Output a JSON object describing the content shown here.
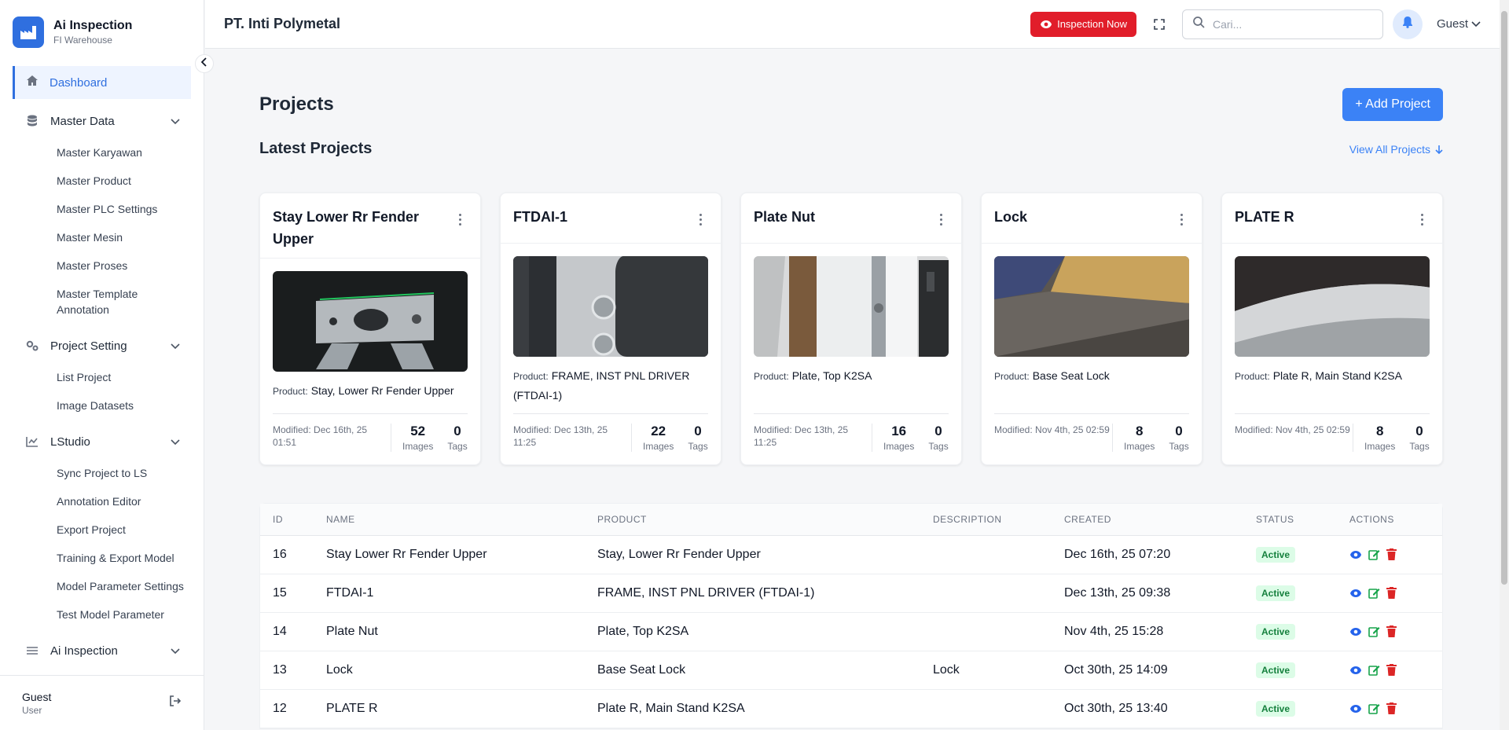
{
  "sidebar": {
    "brand_title": "Ai Inspection",
    "brand_subtitle": "FI Warehouse",
    "dashboard_label": "Dashboard",
    "sections": [
      {
        "label": "Master Data",
        "items": [
          "Master Karyawan",
          "Master Product",
          "Master PLC Settings",
          "Master Mesin",
          "Master Proses",
          "Master Template Annotation"
        ]
      },
      {
        "label": "Project Setting",
        "items": [
          "List Project",
          "Image Datasets"
        ]
      },
      {
        "label": "LStudio",
        "items": [
          "Sync Project to LS",
          "Annotation Editor",
          "Export Project",
          "Training & Export Model",
          "Model Parameter Settings",
          "Test Model Parameter"
        ]
      },
      {
        "label": "Ai Inspection",
        "items": []
      }
    ],
    "footer": {
      "name": "Guest",
      "role": "User"
    }
  },
  "header": {
    "company": "PT. Inti Polymetal",
    "inspection_button": "Inspection Now",
    "search_placeholder": "Cari...",
    "user_label": "Guest"
  },
  "main": {
    "page_title": "Projects",
    "add_button": "+ Add Project",
    "latest_title": "Latest Projects",
    "view_all": "View All Projects",
    "product_label": "Product:",
    "images_label": "Images",
    "tags_label": "Tags",
    "cards": [
      {
        "title": "Stay Lower Rr Fender Upper",
        "product": "Stay, Lower Rr Fender Upper",
        "modified": "Modified: Dec 16th, 25 01:51",
        "images": "52",
        "tags": "0"
      },
      {
        "title": "FTDAI-1",
        "product": "FRAME, INST PNL DRIVER (FTDAI-1)",
        "modified": "Modified: Dec 13th, 25 11:25",
        "images": "22",
        "tags": "0"
      },
      {
        "title": "Plate Nut",
        "product": "Plate, Top K2SA",
        "modified": "Modified: Dec 13th, 25 11:25",
        "images": "16",
        "tags": "0"
      },
      {
        "title": "Lock",
        "product": "Base Seat Lock",
        "modified": "Modified: Nov 4th, 25 02:59",
        "images": "8",
        "tags": "0"
      },
      {
        "title": "PLATE R",
        "product": "Plate R, Main Stand K2SA",
        "modified": "Modified: Nov 4th, 25 02:59",
        "images": "8",
        "tags": "0"
      }
    ],
    "table": {
      "headers": [
        "ID",
        "NAME",
        "PRODUCT",
        "DESCRIPTION",
        "CREATED",
        "STATUS",
        "ACTIONS"
      ],
      "rows": [
        {
          "id": "16",
          "name": "Stay Lower Rr Fender Upper",
          "product": "Stay, Lower Rr Fender Upper",
          "description": "",
          "created": "Dec 16th, 25 07:20",
          "status": "Active"
        },
        {
          "id": "15",
          "name": "FTDAI-1",
          "product": "FRAME, INST PNL DRIVER (FTDAI-1)",
          "description": "",
          "created": "Dec 13th, 25 09:38",
          "status": "Active"
        },
        {
          "id": "14",
          "name": "Plate Nut",
          "product": "Plate, Top K2SA",
          "description": "",
          "created": "Nov 4th, 25 15:28",
          "status": "Active"
        },
        {
          "id": "13",
          "name": "Lock",
          "product": "Base Seat Lock",
          "description": "Lock",
          "created": "Oct 30th, 25 14:09",
          "status": "Active"
        },
        {
          "id": "12",
          "name": "PLATE R",
          "product": "Plate R, Main Stand K2SA",
          "description": "",
          "created": "Oct 30th, 25 13:40",
          "status": "Active"
        }
      ]
    }
  },
  "colors": {
    "accent": "#3b82f6",
    "danger": "#e11d2a",
    "success": "#15803d"
  }
}
